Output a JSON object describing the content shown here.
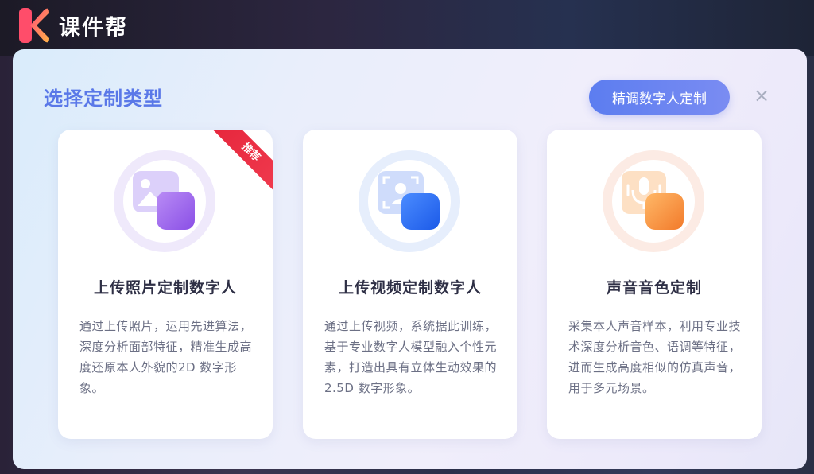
{
  "app": {
    "name": "课件帮"
  },
  "modal": {
    "title": "选择定制类型",
    "premium_button": "精调数字人定制",
    "close_symbol": "×",
    "cards": [
      {
        "title": "上传照片定制数字人",
        "desc": "通过上传照片，运用先进算法，深度分析面部特征，精准生成高度还原本人外貌的2D 数字形象。",
        "badge": "推荐",
        "icon": "image-icon",
        "accent": "#a56af0"
      },
      {
        "title": "上传视频定制数字人",
        "desc": "通过上传视频，系统据此训练，基于专业数字人模型融入个性元素，打造出具有立体生动效果的 2.5D 数字形象。",
        "icon": "video-avatar-icon",
        "accent": "#2f6ff2"
      },
      {
        "title": "声音音色定制",
        "desc": "采集本人声音样本，利用专业技术深度分析音色、语调等特征，进而生成高度相似的仿真声音，用于多元场景。",
        "icon": "microphone-icon",
        "accent": "#f58a3c"
      }
    ]
  }
}
